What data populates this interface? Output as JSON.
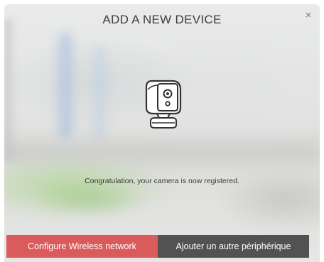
{
  "modal": {
    "title": "ADD A NEW DEVICE",
    "close_label": "×",
    "message": "Congratulation, your camera is now registered.",
    "device_icon": "camera-icon"
  },
  "footer": {
    "primary_label": "Configure Wireless network",
    "secondary_label": "Ajouter un autre périphérique"
  },
  "colors": {
    "primary_button": "#d95b5c",
    "secondary_button": "#525252",
    "title_text": "#3c3c3c"
  }
}
